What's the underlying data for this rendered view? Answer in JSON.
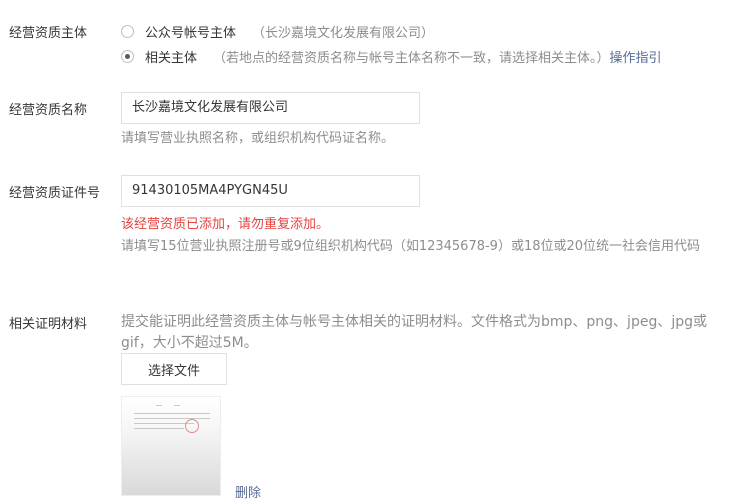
{
  "entity": {
    "label": "经营资质主体",
    "options": [
      {
        "label": "公众号帐号主体",
        "note": "（长沙嘉境文化发展有限公司）",
        "checked": false
      },
      {
        "label": "相关主体",
        "note": "（若地点的经营资质名称与帐号主体名称不一致，请选择相关主体。）",
        "link": "操作指引",
        "checked": true
      }
    ]
  },
  "name": {
    "label": "经营资质名称",
    "value": "长沙嘉境文化发展有限公司",
    "hint": "请填写营业执照名称，或组织机构代码证名称。"
  },
  "cert": {
    "label": "经营资质证件号",
    "value": "91430105MA4PYGN45U",
    "error": "该经营资质已添加，请勿重复添加。",
    "hint": "请填写15位营业执照注册号或9位组织机构代码（如12345678-9）或18位或20位统一社会信用代码"
  },
  "material": {
    "label": "相关证明材料",
    "hint": "提交能证明此经营资质主体与帐号主体相关的证明材料。文件格式为bmp、png、jpeg、jpg或gif，大小不超过5M。",
    "button": "选择文件",
    "delete": "删除"
  }
}
